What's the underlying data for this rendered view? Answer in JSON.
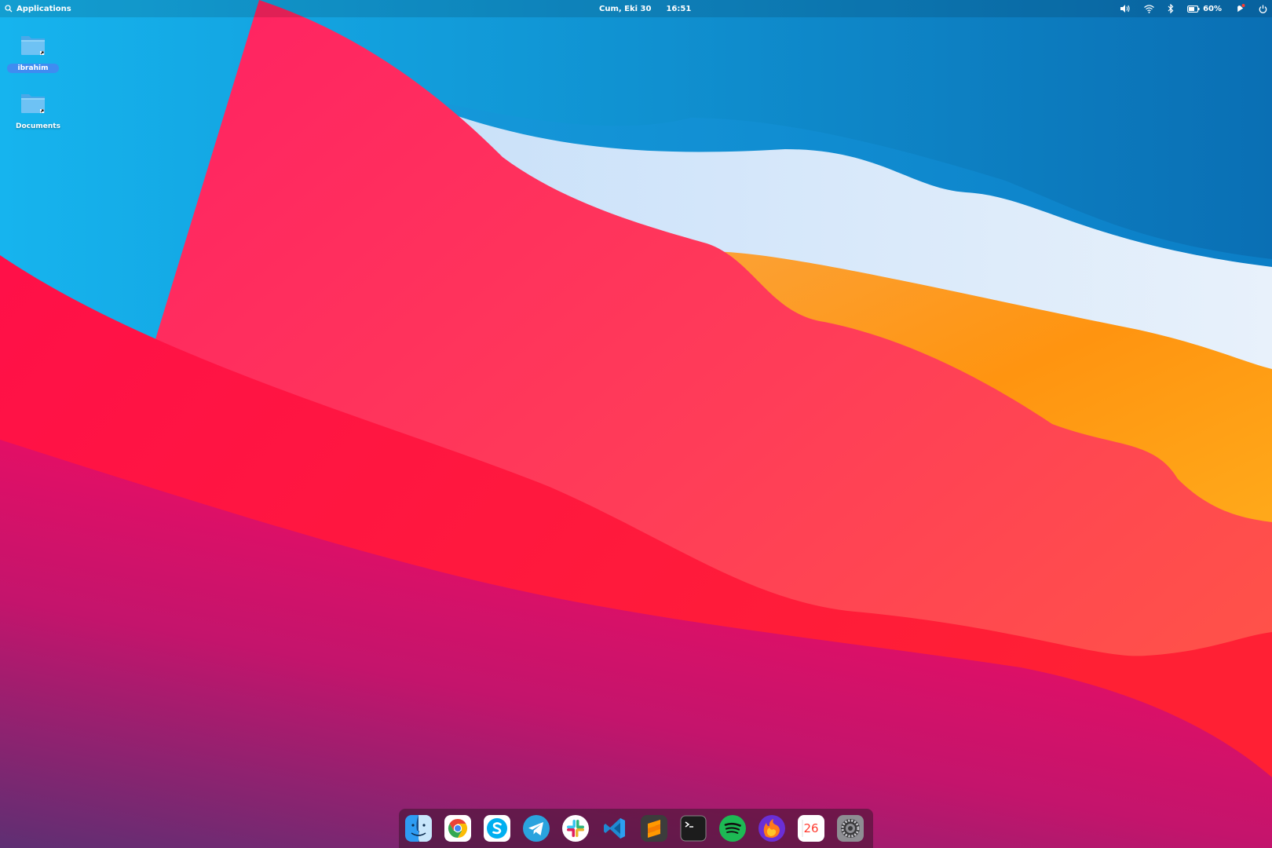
{
  "top_panel": {
    "applications_label": "Applications",
    "date": "Cum, Eki 30",
    "time": "16:51",
    "battery_percent": "60%",
    "icons": [
      "search-icon",
      "volume-icon",
      "wifi-icon",
      "bluetooth-icon",
      "battery-icon",
      "notifications-icon",
      "power-icon"
    ]
  },
  "desktop_icons": [
    {
      "label": "ibrahim",
      "icon": "folder-link-icon",
      "selected": true
    },
    {
      "label": "Documents",
      "icon": "folder-link-icon",
      "selected": false
    }
  ],
  "dock": {
    "apps": [
      "Finder",
      "Google Chrome",
      "Skype",
      "Telegram",
      "Slack",
      "Visual Studio Code",
      "Sublime Text",
      "Terminal",
      "Spotify",
      "Firefox",
      "Calendar",
      "System Settings"
    ],
    "calendar_day": "26"
  },
  "colors": {
    "selection": "#3f8cf1",
    "wallpaper_red": "#ff1f5a",
    "wallpaper_blue": "#1296d8",
    "wallpaper_orange": "#ff9f1a"
  }
}
